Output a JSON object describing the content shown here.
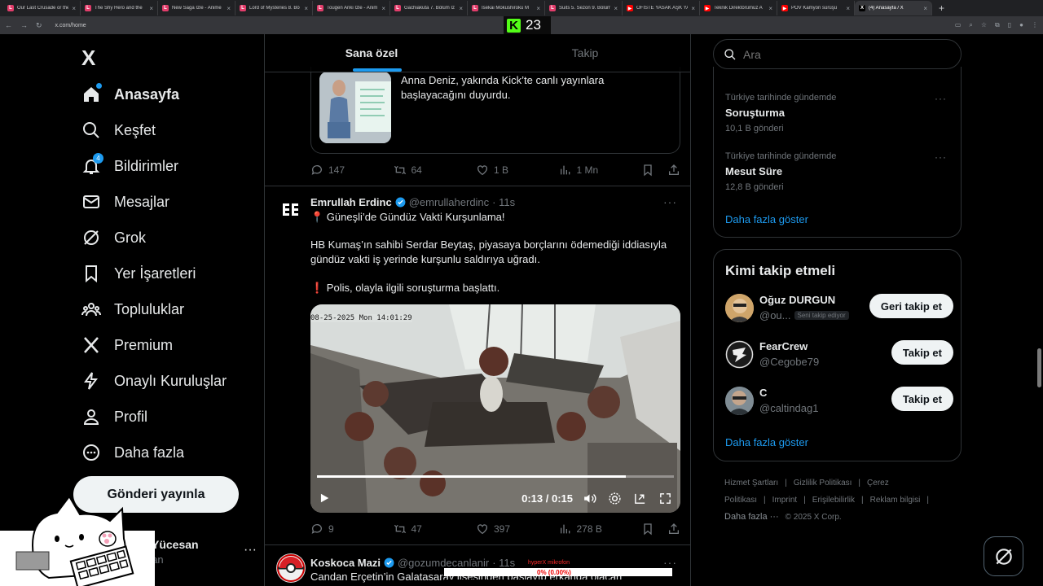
{
  "browser": {
    "tabs": [
      {
        "title": "Our Last Crusade or the",
        "fav": "L",
        "color": "#e23d6b"
      },
      {
        "title": "The Shy Hero and the",
        "fav": "L",
        "color": "#e23d6b"
      },
      {
        "title": "New Saga İzle - Anime",
        "fav": "L",
        "color": "#e23d6b"
      },
      {
        "title": "Lord of Mysteries 8. Bö",
        "fav": "L",
        "color": "#e23d6b"
      },
      {
        "title": "Tougen Anki İzle - Anim",
        "fav": "L",
        "color": "#e23d6b"
      },
      {
        "title": "Gachiakuta 7. Bölüm İz",
        "fav": "L",
        "color": "#e23d6b"
      },
      {
        "title": "Isekai Mokushiroku M",
        "fav": "L",
        "color": "#e23d6b"
      },
      {
        "title": "Suits 5. Sezon 9. Bölüm",
        "fav": "L",
        "color": "#e23d6b"
      },
      {
        "title": "OFİSTE YASAK AŞK YA",
        "fav": "▶",
        "color": "#ff0000"
      },
      {
        "title": "Teknik Direktörümüz A",
        "fav": "▶",
        "color": "#ff0000"
      },
      {
        "title": "POV Kamyon sürüşü",
        "fav": "▶",
        "color": "#ff0000"
      },
      {
        "title": "(4) Anasayfa / X",
        "fav": "X",
        "color": "#000000"
      }
    ],
    "url": "x.com/home",
    "kick_count": "23"
  },
  "sidebar": {
    "logo": "X",
    "items": [
      {
        "label": "Anasayfa",
        "icon": "home-icon",
        "bold": true
      },
      {
        "label": "Keşfet",
        "icon": "search-icon"
      },
      {
        "label": "Bildirimler",
        "icon": "bell-icon",
        "badge": "4"
      },
      {
        "label": "Mesajlar",
        "icon": "mail-icon"
      },
      {
        "label": "Grok",
        "icon": "grok-icon"
      },
      {
        "label": "Yer İşaretleri",
        "icon": "bookmark-icon"
      },
      {
        "label": "Topluluklar",
        "icon": "communities-icon"
      },
      {
        "label": "Premium",
        "icon": "x-premium-icon"
      },
      {
        "label": "Onaylı Kuruluşlar",
        "icon": "lightning-icon"
      },
      {
        "label": "Profil",
        "icon": "profile-icon"
      },
      {
        "label": "Daha fazla",
        "icon": "more-circle-icon"
      }
    ],
    "post_button": "Gönderi yayınla",
    "account": {
      "name": "arkan Yücesan",
      "handle": "anBarkan",
      "more": "···"
    }
  },
  "timeline": {
    "tabs": [
      "Sana özel",
      "Takip"
    ],
    "post1": {
      "card_text": "Anna Deniz, yakında Kick’te canlı yayınlara başlayacağını duyurdu.",
      "replies": "147",
      "reposts": "64",
      "likes": "1 B",
      "views": "1 Mn"
    },
    "post2": {
      "name": "Emrullah Erdinc",
      "handle": "@emrullaherdinc",
      "time": "· 11s",
      "line1": "📍 Güneşli’de Gündüz Vakti Kurşunlama!",
      "line2": "HB Kumaş’ın sahibi Serdar Beytaş, piyasaya borçlarını ödemediği iddiasıyla gündüz vakti iş yerinde kurşunlu saldırıya uğradı.",
      "line3": "❗ Polis, olayla ilgili soruşturma başlattı.",
      "video_timestamp": "08-25-2025 Mon 14:01:29",
      "video_time": "0:13 / 0:15",
      "video_progress": 0.866,
      "replies": "9",
      "reposts": "47",
      "likes": "397",
      "views": "278 B"
    },
    "post3": {
      "name": "Koskoca Mazi",
      "handle": "@gozumdecanlanir",
      "time": "· 11s",
      "line1": "Candan Erçetin’in Galatasaray lisesinden başlayıp erkanda olacan"
    }
  },
  "right": {
    "search_placeholder": "Ara",
    "trends": [
      {
        "context": "Türkiye tarihinde gündemde",
        "name": "Soruşturma",
        "posts": "10,1 B gönderi"
      },
      {
        "context": "Türkiye tarihinde gündemde",
        "name": "Mesut Süre",
        "posts": "12,8 B gönderi"
      }
    ],
    "show_more": "Daha fazla göster",
    "wtf_title": "Kimi takip etmeli",
    "who_to_follow": [
      {
        "name": "Oğuz DURGUN",
        "handle": "@ou...",
        "follows_you": "Seni takip ediyor",
        "button": "Geri takip et"
      },
      {
        "name": "FearCrew",
        "handle": "@Cegobe79",
        "button": "Takip et"
      },
      {
        "name": "C",
        "handle": "@caltindag1",
        "button": "Takip et"
      }
    ],
    "show_more2": "Daha fazla göster",
    "footer": [
      "Hizmet Şartları",
      "|",
      "Gizlilik Politikası",
      "|",
      "Çerez Politikası",
      "|",
      "Imprint",
      "|",
      "Erişilebilirlik",
      "|",
      "Reklam bilgisi",
      "|"
    ],
    "footer_more": "Daha fazla ···",
    "copyright": "© 2025 X Corp."
  },
  "overlay": {
    "mic_label": "hyperX mikrofon",
    "mic_value": "0% (0.00%)"
  }
}
